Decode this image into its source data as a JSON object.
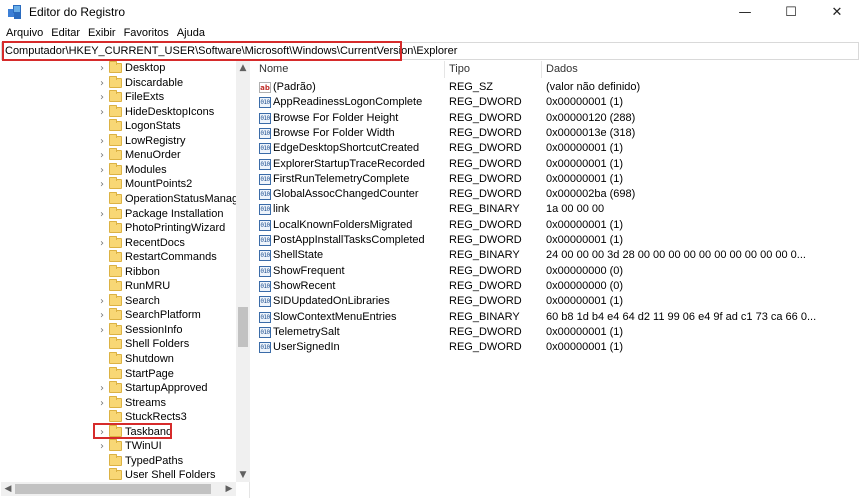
{
  "window": {
    "title": "Editor do Registro",
    "controls": {
      "minimize": "—",
      "maximize": "☐",
      "close": "✕"
    }
  },
  "menu": [
    "Arquivo",
    "Editar",
    "Exibir",
    "Favoritos",
    "Ajuda"
  ],
  "address": "Computador\\HKEY_CURRENT_USER\\Software\\Microsoft\\Windows\\CurrentVersion\\Explorer",
  "tree": {
    "items": [
      {
        "label": "Desktop",
        "expandable": true
      },
      {
        "label": "Discardable",
        "expandable": true
      },
      {
        "label": "FileExts",
        "expandable": true
      },
      {
        "label": "HideDesktopIcons",
        "expandable": true
      },
      {
        "label": "LogonStats",
        "expandable": false
      },
      {
        "label": "LowRegistry",
        "expandable": true
      },
      {
        "label": "MenuOrder",
        "expandable": true
      },
      {
        "label": "Modules",
        "expandable": true
      },
      {
        "label": "MountPoints2",
        "expandable": true
      },
      {
        "label": "OperationStatusManager",
        "expandable": false
      },
      {
        "label": "Package Installation",
        "expandable": true
      },
      {
        "label": "PhotoPrintingWizard",
        "expandable": false
      },
      {
        "label": "RecentDocs",
        "expandable": true
      },
      {
        "label": "RestartCommands",
        "expandable": false
      },
      {
        "label": "Ribbon",
        "expandable": false
      },
      {
        "label": "RunMRU",
        "expandable": false
      },
      {
        "label": "Search",
        "expandable": true
      },
      {
        "label": "SearchPlatform",
        "expandable": true
      },
      {
        "label": "SessionInfo",
        "expandable": true
      },
      {
        "label": "Shell Folders",
        "expandable": false
      },
      {
        "label": "Shutdown",
        "expandable": false
      },
      {
        "label": "StartPage",
        "expandable": false
      },
      {
        "label": "StartupApproved",
        "expandable": true
      },
      {
        "label": "Streams",
        "expandable": true
      },
      {
        "label": "StuckRects3",
        "expandable": false
      },
      {
        "label": "Taskband",
        "expandable": true
      },
      {
        "label": "TWinUI",
        "expandable": true
      },
      {
        "label": "TypedPaths",
        "expandable": false
      },
      {
        "label": "User Shell Folders",
        "expandable": false
      }
    ],
    "highlighted": "Taskband"
  },
  "columns": {
    "name": "Nome",
    "type": "Tipo",
    "data": "Dados"
  },
  "values": [
    {
      "icon": "string-value-icon",
      "glyph": "ab",
      "name": "(Padrão)",
      "type": "REG_SZ",
      "data": "(valor não definido)"
    },
    {
      "icon": "binary-value-icon",
      "glyph": "010",
      "name": "AppReadinessLogonComplete",
      "type": "REG_DWORD",
      "data": "0x00000001 (1)"
    },
    {
      "icon": "binary-value-icon",
      "glyph": "010",
      "name": "Browse For Folder Height",
      "type": "REG_DWORD",
      "data": "0x00000120 (288)"
    },
    {
      "icon": "binary-value-icon",
      "glyph": "010",
      "name": "Browse For Folder Width",
      "type": "REG_DWORD",
      "data": "0x0000013e (318)"
    },
    {
      "icon": "binary-value-icon",
      "glyph": "010",
      "name": "EdgeDesktopShortcutCreated",
      "type": "REG_DWORD",
      "data": "0x00000001 (1)"
    },
    {
      "icon": "binary-value-icon",
      "glyph": "010",
      "name": "ExplorerStartupTraceRecorded",
      "type": "REG_DWORD",
      "data": "0x00000001 (1)"
    },
    {
      "icon": "binary-value-icon",
      "glyph": "010",
      "name": "FirstRunTelemetryComplete",
      "type": "REG_DWORD",
      "data": "0x00000001 (1)"
    },
    {
      "icon": "binary-value-icon",
      "glyph": "010",
      "name": "GlobalAssocChangedCounter",
      "type": "REG_DWORD",
      "data": "0x000002ba (698)"
    },
    {
      "icon": "binary-value-icon",
      "glyph": "010",
      "name": "link",
      "type": "REG_BINARY",
      "data": "1a 00 00 00"
    },
    {
      "icon": "binary-value-icon",
      "glyph": "010",
      "name": "LocalKnownFoldersMigrated",
      "type": "REG_DWORD",
      "data": "0x00000001 (1)"
    },
    {
      "icon": "binary-value-icon",
      "glyph": "010",
      "name": "PostAppInstallTasksCompleted",
      "type": "REG_DWORD",
      "data": "0x00000001 (1)"
    },
    {
      "icon": "binary-value-icon",
      "glyph": "010",
      "name": "ShellState",
      "type": "REG_BINARY",
      "data": "24 00 00 00 3d 28 00 00 00 00 00 00 00 00 00 00 0..."
    },
    {
      "icon": "binary-value-icon",
      "glyph": "010",
      "name": "ShowFrequent",
      "type": "REG_DWORD",
      "data": "0x00000000 (0)"
    },
    {
      "icon": "binary-value-icon",
      "glyph": "010",
      "name": "ShowRecent",
      "type": "REG_DWORD",
      "data": "0x00000000 (0)"
    },
    {
      "icon": "binary-value-icon",
      "glyph": "010",
      "name": "SIDUpdatedOnLibraries",
      "type": "REG_DWORD",
      "data": "0x00000001 (1)"
    },
    {
      "icon": "binary-value-icon",
      "glyph": "010",
      "name": "SlowContextMenuEntries",
      "type": "REG_BINARY",
      "data": "60 b8 1d b4 e4 64 d2 11 99 06 e4 9f ad c1 73 ca 66 0..."
    },
    {
      "icon": "binary-value-icon",
      "glyph": "010",
      "name": "TelemetrySalt",
      "type": "REG_DWORD",
      "data": "0x00000001 (1)"
    },
    {
      "icon": "binary-value-icon",
      "glyph": "010",
      "name": "UserSignedIn",
      "type": "REG_DWORD",
      "data": "0x00000001 (1)"
    }
  ],
  "scroll": {
    "up": "▲",
    "down": "▼",
    "left": "◀",
    "right": "▶"
  },
  "colors": {
    "highlight_border": "#d62b2b",
    "folder": "#f8d775"
  }
}
